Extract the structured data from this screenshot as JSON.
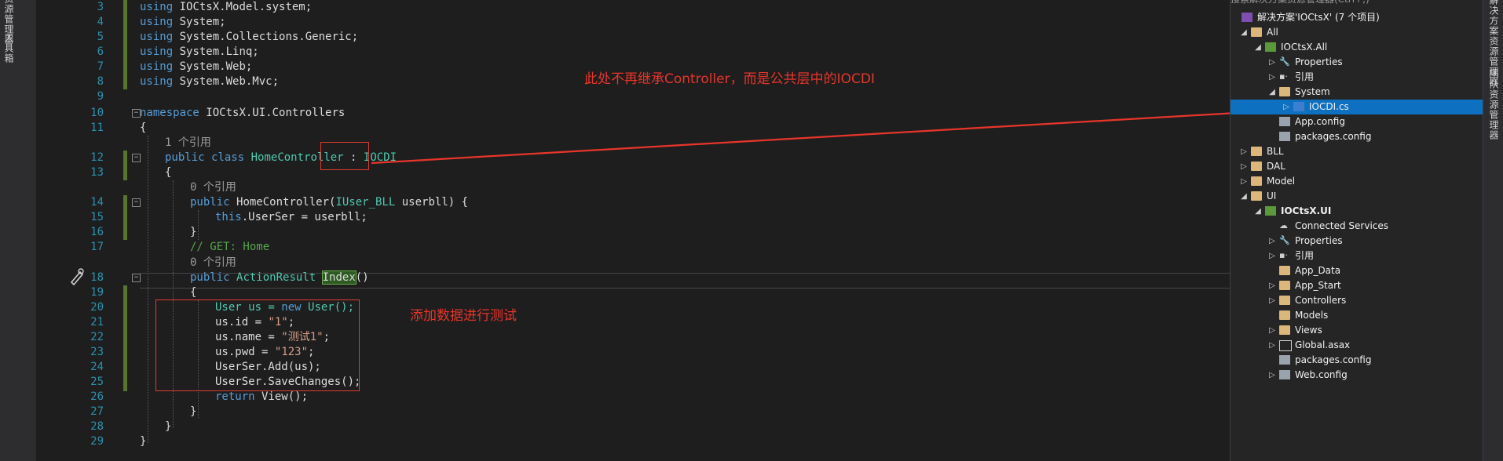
{
  "left_panel": {
    "labels": [
      "资源管理器",
      "工具箱"
    ]
  },
  "right_panel": {
    "labels": [
      "解决方案资源管理器",
      "团队资源管理器"
    ]
  },
  "editor": {
    "lines": [
      {
        "num": "3"
      },
      {
        "num": "4"
      },
      {
        "num": "5"
      },
      {
        "num": "6"
      },
      {
        "num": "7"
      },
      {
        "num": "8"
      },
      {
        "num": "9"
      },
      {
        "num": "10"
      },
      {
        "num": "11"
      },
      {
        "num": "12"
      },
      {
        "num": "13"
      },
      {
        "num": "14"
      },
      {
        "num": "15"
      },
      {
        "num": "16"
      },
      {
        "num": "17"
      },
      {
        "num": "18"
      },
      {
        "num": "19"
      },
      {
        "num": "20"
      },
      {
        "num": "21"
      },
      {
        "num": "22"
      },
      {
        "num": "23"
      },
      {
        "num": "24"
      },
      {
        "num": "25"
      },
      {
        "num": "26"
      },
      {
        "num": "27"
      },
      {
        "num": "28"
      },
      {
        "num": "29"
      }
    ],
    "using_kw": "using",
    "usings": [
      "IOCtsX.Model.system;",
      "System;",
      "System.Collections.Generic;",
      "System.Linq;",
      "System.Web;",
      "System.Web.Mvc;"
    ],
    "ns_kw": "namespace",
    "ns_name": "IOCtsX.UI.Controllers",
    "open_brace": "{",
    "close_brace": "}",
    "ref1": "1 个引用",
    "ref0": "0 个引用",
    "public_kw": "public",
    "class_kw": "class",
    "class_name": "HomeController",
    "colon": " : ",
    "base_class": "IOCDI",
    "ctor_name": "HomeController(",
    "ctor_param_type": "IUser_BLL",
    "ctor_param": " userbll) {",
    "this_kw": "this",
    "assign_text": ".UserSer = userbll;",
    "comment": "// GET: Home",
    "return_type": "ActionResult",
    "method_name": "Index",
    "parens": "()",
    "body": {
      "l20_a": "User us = ",
      "new_kw": "new",
      "l20_b": " User();",
      "l21_a": "us.id = ",
      "l21_str": "\"1\"",
      "l22_a": "us.name = ",
      "l22_str": "\"测试1\"",
      "l23_a": "us.pwd = ",
      "l23_str": "\"123\"",
      "semicolon": ";",
      "l24": "UserSer.Add(us);",
      "l25": "UserSer.SaveChanges();",
      "return_kw": "return",
      "l26": " View();"
    }
  },
  "annotations": {
    "inherit_note": "此处不再继承Controller，而是公共层中的IOCDI",
    "test_note": "添加数据进行测试"
  },
  "solution_explorer": {
    "header_partial": "搜索解决方案资源管理器(Ctrl+;)",
    "items": [
      {
        "label": "解决方案'IOCtsX' (7 个项目)",
        "icon": "solution-icon",
        "arrow": ""
      },
      {
        "label": "All",
        "icon": "folder-icon",
        "arrow": "◢"
      },
      {
        "label": "IOCtsX.All",
        "icon": "csharp-project-icon",
        "arrow": "◢"
      },
      {
        "label": "Properties",
        "icon": "wrench-icon",
        "arrow": "▷"
      },
      {
        "label": "引用",
        "icon": "references-icon",
        "arrow": "▷"
      },
      {
        "label": "System",
        "icon": "folder-icon",
        "arrow": "◢"
      },
      {
        "label": "IOCDI.cs",
        "icon": "csharp-file-icon",
        "arrow": "▷"
      },
      {
        "label": "App.config",
        "icon": "config-icon",
        "arrow": ""
      },
      {
        "label": "packages.config",
        "icon": "config-icon",
        "arrow": ""
      },
      {
        "label": "BLL",
        "icon": "folder-icon",
        "arrow": "▷"
      },
      {
        "label": "DAL",
        "icon": "folder-icon",
        "arrow": "▷"
      },
      {
        "label": "Model",
        "icon": "folder-icon",
        "arrow": "▷"
      },
      {
        "label": "UI",
        "icon": "folder-icon",
        "arrow": "◢"
      },
      {
        "label": "IOCtsX.UI",
        "icon": "web-project-icon",
        "arrow": "◢"
      },
      {
        "label": "Connected Services",
        "icon": "connected-services-icon",
        "arrow": ""
      },
      {
        "label": "Properties",
        "icon": "wrench-icon",
        "arrow": "▷"
      },
      {
        "label": "引用",
        "icon": "references-icon",
        "arrow": "▷"
      },
      {
        "label": "App_Data",
        "icon": "folder-icon",
        "arrow": ""
      },
      {
        "label": "App_Start",
        "icon": "folder-icon",
        "arrow": "▷"
      },
      {
        "label": "Controllers",
        "icon": "folder-icon",
        "arrow": "▷"
      },
      {
        "label": "Models",
        "icon": "folder-icon",
        "arrow": ""
      },
      {
        "label": "Views",
        "icon": "folder-icon",
        "arrow": "▷"
      },
      {
        "label": "Global.asax",
        "icon": "global-icon",
        "arrow": "▷"
      },
      {
        "label": "packages.config",
        "icon": "config-icon",
        "arrow": ""
      },
      {
        "label": "Web.config",
        "icon": "config-icon",
        "arrow": "▷"
      }
    ]
  },
  "colors": {
    "annotation": "#e8352a",
    "selection": "#0e70c0",
    "keyword": "#569cd6",
    "type": "#4ec9b0",
    "string": "#d69d85",
    "comment": "#57a64a"
  }
}
